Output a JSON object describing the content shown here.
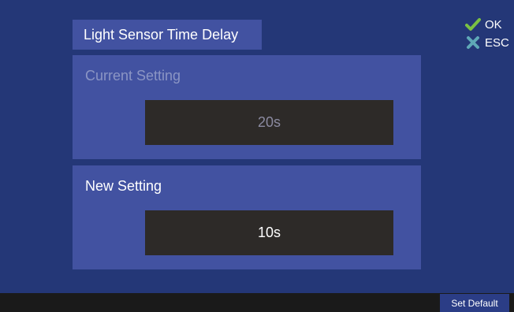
{
  "screen_title": "Light Sensor Time Delay",
  "keys": {
    "ok_label": "OK",
    "esc_label": "ESC",
    "ok_icon": "check-icon",
    "esc_icon": "close-icon",
    "ok_color": "#7ac143",
    "esc_color": "#5fa9b7"
  },
  "current_setting": {
    "label": "Current Setting",
    "value": "20s"
  },
  "new_setting": {
    "label": "New Setting",
    "value": "10s"
  },
  "footer": {
    "set_default_label": "Set Default"
  },
  "colors": {
    "background": "#243777",
    "panel": "#4252a1",
    "value_box": "#2d2a28"
  }
}
